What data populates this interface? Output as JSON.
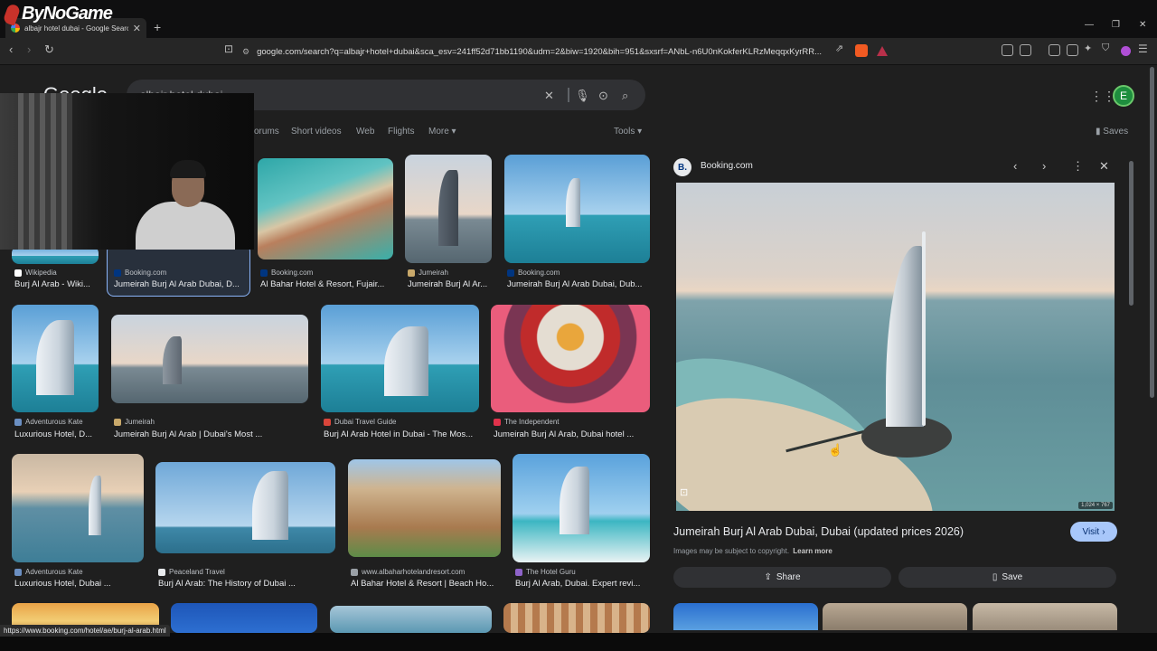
{
  "browser": {
    "tab_title": "albajr hotel dubai - Google Search",
    "url": "google.com/search?q=albajr+hotel+dubai&sca_esv=241ff52d71bb1190&udm=2&biw=1920&bih=951&sxsrf=ANbL-n6U0nKokferKLRzMeqqxKyrRR...",
    "new_tab_symbol": "+",
    "status_url": "https://www.booking.com/hotel/ae/burj-al-arab.html"
  },
  "overlay_logo": "ByNoGame",
  "google": {
    "logo": "Google",
    "query": "albajr hotel dubai",
    "avatar_letter": "E",
    "filters": [
      "orums",
      "Short videos",
      "Web",
      "Flights",
      "More ▾"
    ],
    "tools": "Tools ▾",
    "saves": "Saves"
  },
  "results": [
    {
      "source": "Wikipedia",
      "caption": "Burj Al Arab - Wiki...",
      "src_color": "#ffffff"
    },
    {
      "source": "Booking.com",
      "caption": "Jumeirah Burj Al Arab Dubai, D...",
      "src_color": "#003580"
    },
    {
      "source": "Booking.com",
      "caption": "Al Bahar Hotel & Resort, Fujair...",
      "src_color": "#003580"
    },
    {
      "source": "Jumeirah",
      "caption": "Jumeirah Burj Al Ar...",
      "src_color": "#c8a86a"
    },
    {
      "source": "Booking.com",
      "caption": "Jumeirah Burj Al Arab Dubai, Dub...",
      "src_color": "#003580"
    },
    {
      "source": "Adventurous Kate",
      "caption": "Luxurious Hotel, D...",
      "src_color": "#6b8fc2"
    },
    {
      "source": "Jumeirah",
      "caption": "Jumeirah Burj Al Arab | Dubai's Most ...",
      "src_color": "#c8a86a"
    },
    {
      "source": "Dubai Travel Guide",
      "caption": "Burj Al Arab Hotel in Dubai - The Mos...",
      "src_color": "#d9453a"
    },
    {
      "source": "The Independent",
      "caption": "Jumeirah Burj Al Arab, Dubai hotel ...",
      "src_color": "#e0324b"
    },
    {
      "source": "Adventurous Kate",
      "caption": "Luxurious Hotel, Dubai ...",
      "src_color": "#6b8fc2"
    },
    {
      "source": "Peaceland Travel",
      "caption": "Burj Al Arab: The History of Dubai ...",
      "src_color": "#e8eaed"
    },
    {
      "source": "www.albaharhotelandresort.com",
      "caption": "Al Bahar Hotel & Resort | Beach Ho...",
      "src_color": "#9aa0a6"
    },
    {
      "source": "The Hotel Guru",
      "caption": "Burj Al Arab, Dubai. Expert revi...",
      "src_color": "#8e63c9"
    }
  ],
  "panel": {
    "source": "Booking.com",
    "source_letter": "B.",
    "title": "Jumeirah Burj Al Arab Dubai, Dubai (updated prices 2026)",
    "visit_label": "Visit",
    "copyright": "Images may be subject to copyright.",
    "learn_more": "Learn more",
    "share_label": "Share",
    "save_label": "Save",
    "dimensions": "1,024 × 767"
  }
}
